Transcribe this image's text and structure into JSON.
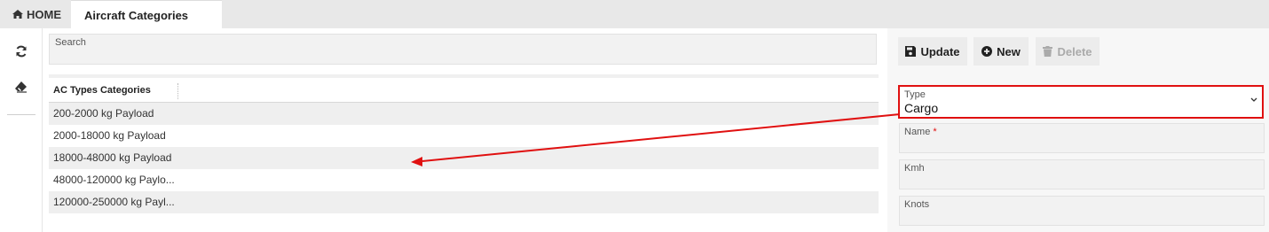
{
  "tabs": {
    "home_label": "HOME",
    "active_label": "Aircraft Categories"
  },
  "toolbar": {
    "refresh_icon": "refresh-icon",
    "eraser_icon": "eraser-icon"
  },
  "search": {
    "label": "Search"
  },
  "grid": {
    "column_header": "AC Types Categories",
    "rows": [
      "200-2000 kg Payload",
      "2000-18000 kg Payload",
      "18000-48000 kg Payload",
      "48000-120000 kg Paylo...",
      "120000-250000 kg Payl..."
    ]
  },
  "actions": {
    "update_label": "Update",
    "new_label": "New",
    "delete_label": "Delete"
  },
  "form": {
    "type_label": "Type",
    "type_value": "Cargo",
    "name_label": "Name",
    "name_required": "*",
    "kmh_label": "Kmh",
    "knots_label": "Knots"
  },
  "colors": {
    "highlight": "#e01010",
    "annotation_arrow": "#e01010"
  }
}
